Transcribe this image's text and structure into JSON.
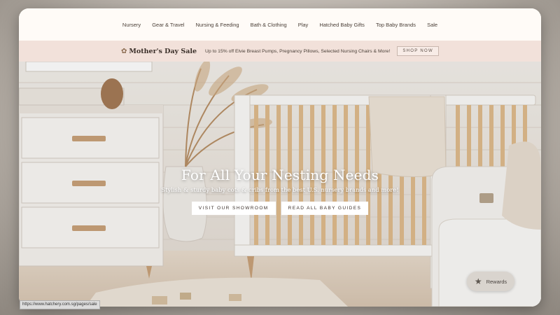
{
  "nav": {
    "items": [
      "Nursery",
      "Gear & Travel",
      "Nursing & Feeding",
      "Bath & Clothing",
      "Play",
      "Hatched Baby Gifts",
      "Top Baby Brands",
      "Sale"
    ]
  },
  "promo": {
    "title": "Mother's Day Sale",
    "description": "Up to 15% off Elvie Breast Pumps, Pregnancy Pillows, Selected Nursing Chairs & More!",
    "button": "SHOP NOW",
    "icon": "bird-icon"
  },
  "hero": {
    "title": "For All Your Nesting Needs",
    "subtitle": "Stylish & sturdy baby cots & cribs from the best U.S. nursery brands and more!",
    "cta_primary": "VISIT OUR SHOWROOM",
    "cta_secondary": "READ ALL BABY GUIDES"
  },
  "rewards": {
    "label": "Rewards",
    "icon": "star-icon"
  },
  "status_bar": {
    "url": "https://www.hatchery.com.sg/pages/sale"
  },
  "colors": {
    "promo_bg": "#f2e1da",
    "nav_bg": "#fffbf7",
    "cta_bg": "#ffffff"
  }
}
